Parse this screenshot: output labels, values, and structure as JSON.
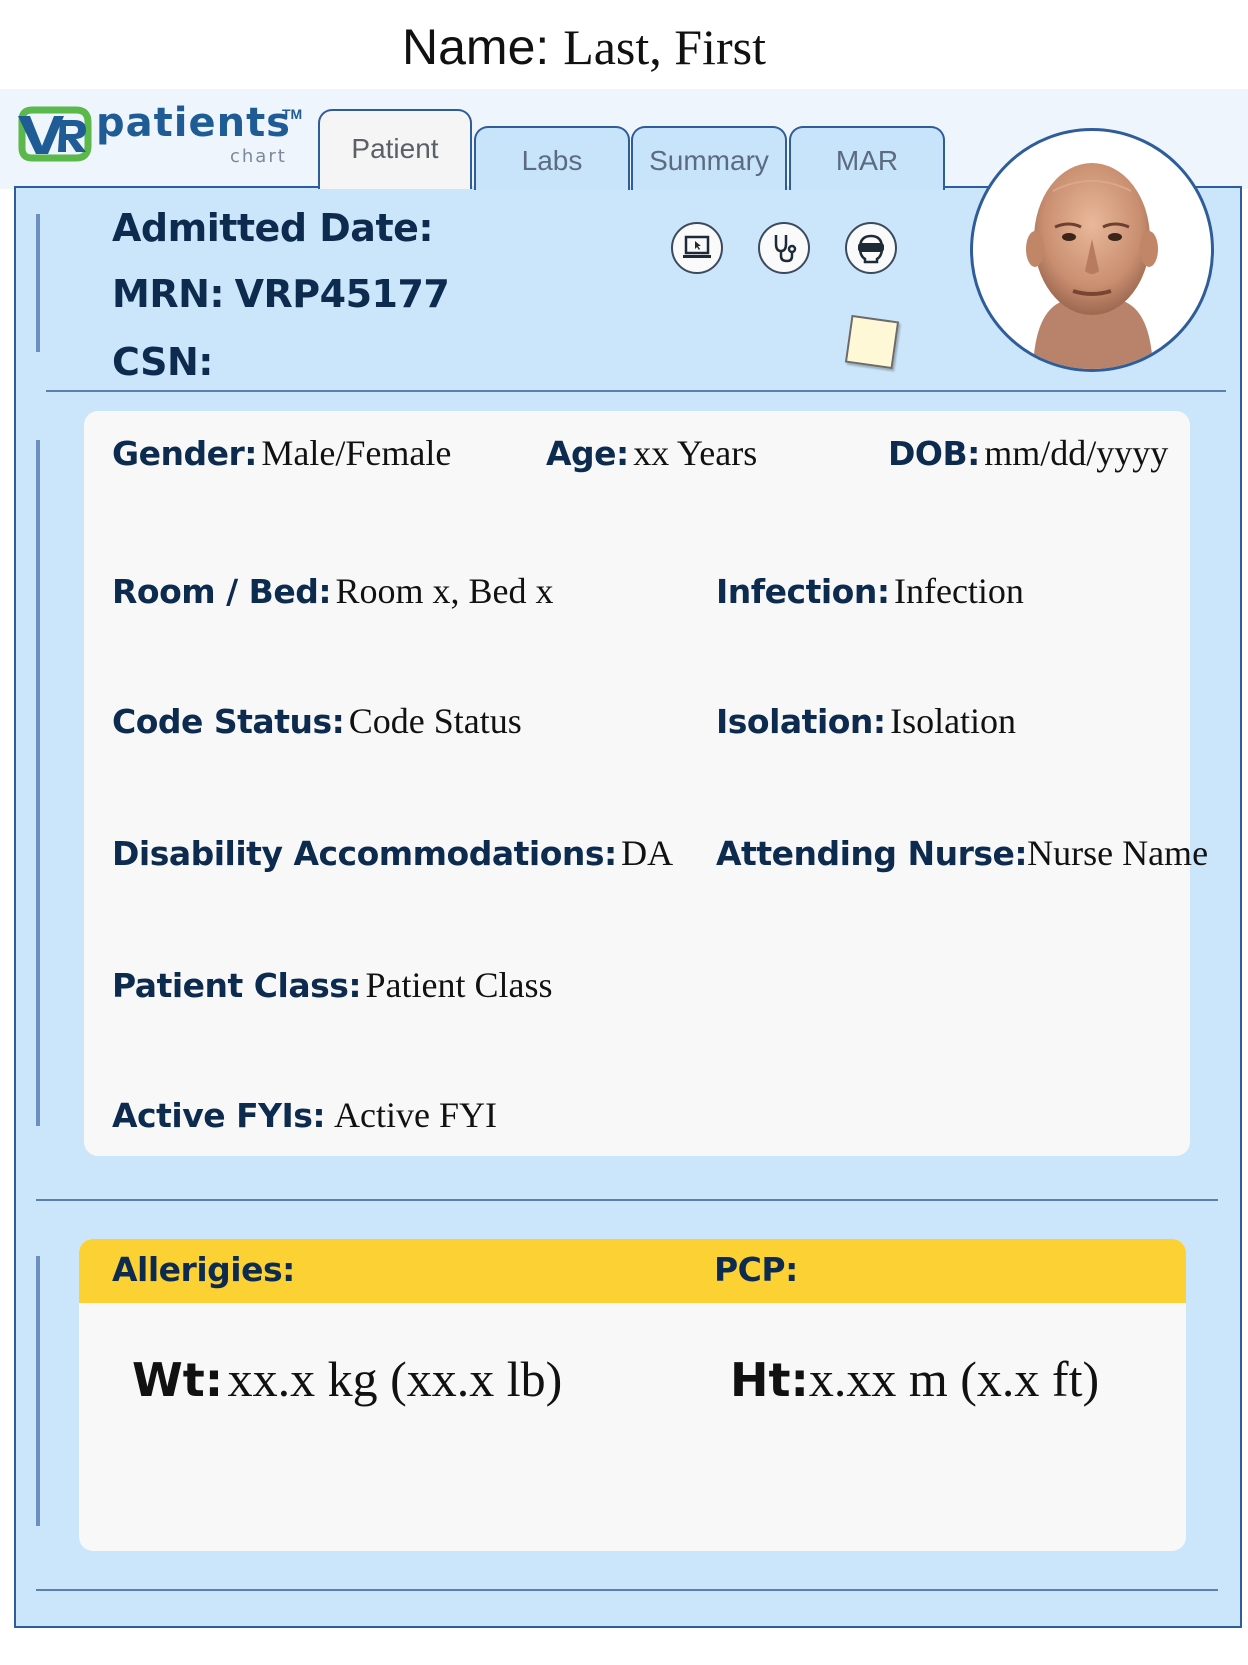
{
  "header": {
    "name_label": "Name:",
    "name_value": "Last, First"
  },
  "logo": {
    "mark": "VR",
    "text": "patients",
    "sub": "chart",
    "tm": "TM"
  },
  "tabs": [
    {
      "label": "Patient",
      "active": true
    },
    {
      "label": "Labs",
      "active": false
    },
    {
      "label": "Summary",
      "active": false
    },
    {
      "label": "MAR",
      "active": false
    }
  ],
  "patient_header": {
    "admitted_label": "Admitted Date:",
    "mrn_label": "MRN:",
    "mrn_value": "VRP45177",
    "csn_label": "CSN:"
  },
  "icons": [
    "computer-icon",
    "stethoscope-icon",
    "vr-headset-icon",
    "sticky-note-icon"
  ],
  "fields": {
    "gender": {
      "label": "Gender:",
      "value": "Male/Female"
    },
    "age": {
      "label": "Age:",
      "value": "xx Years"
    },
    "dob": {
      "label": "DOB:",
      "value": "mm/dd/yyyy"
    },
    "room": {
      "label": "Room / Bed:",
      "value": "Room x, Bed x"
    },
    "infection": {
      "label": "Infection:",
      "value": "Infection"
    },
    "code_status": {
      "label": "Code Status:",
      "value": "Code Status"
    },
    "isolation": {
      "label": "Isolation:",
      "value": "Isolation"
    },
    "disability": {
      "label": "Disability Accommodations:",
      "value": "DA"
    },
    "nurse": {
      "label": "Attending Nurse:",
      "value": "Nurse Name"
    },
    "patient_class": {
      "label": "Patient Class:",
      "value": "Patient Class"
    },
    "fyi": {
      "label": "Active FYIs:",
      "value": "Active FYI"
    }
  },
  "allergies": {
    "allergies_label": "Allerigies:",
    "pcp_label": "PCP:",
    "wt_label": "Wt:",
    "wt_value": "xx.x kg (xx.x lb)",
    "ht_label": "Ht:",
    "ht_value": "x.xx m (x.x ft)"
  },
  "colors": {
    "panel": "#cbe6fb",
    "border": "#2f5d9a",
    "label": "#0d2b4e",
    "allergy_bar": "#fbd133",
    "logo_green": "#5bb84a",
    "logo_blue": "#1f5c96"
  }
}
